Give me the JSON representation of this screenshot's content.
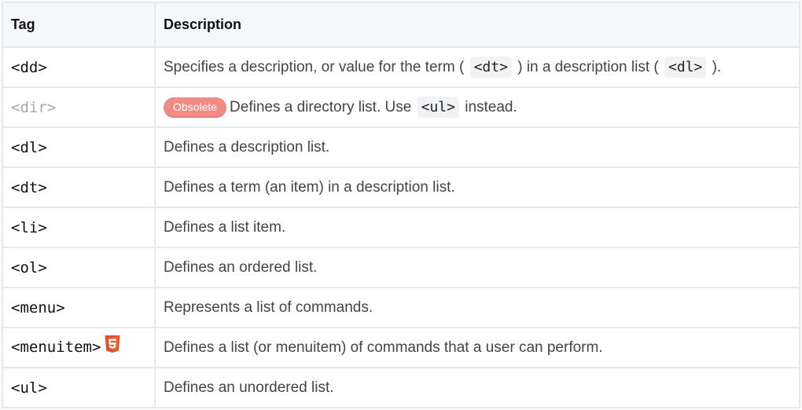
{
  "table": {
    "headers": {
      "tag": "Tag",
      "description": "Description"
    },
    "rows": [
      {
        "tag": "<dd>",
        "parts": [
          "Specifies a description, or value for the term (",
          "<dt>",
          ") in a description list (",
          "<dl>",
          ")."
        ]
      },
      {
        "tag": "<dir>",
        "badge": "Obsolete",
        "parts": [
          "Defines a directory list. Use",
          "<ul>",
          "instead."
        ]
      },
      {
        "tag": "<dl>",
        "description": "Defines a description list."
      },
      {
        "tag": "<dt>",
        "description": "Defines a term (an item) in a description list."
      },
      {
        "tag": "<li>",
        "description": "Defines a list item."
      },
      {
        "tag": "<ol>",
        "description": "Defines an ordered list."
      },
      {
        "tag": "<menu>",
        "description": "Represents a list of commands."
      },
      {
        "tag": "<menuitem>",
        "icon": "html5-icon",
        "description": "Defines a list (or menuitem) of commands that a user can perform."
      },
      {
        "tag": "<ul>",
        "description": "Defines an unordered list."
      }
    ]
  },
  "colors": {
    "badge": "#f28b85",
    "html5": "#e34f26",
    "border": "#e3e9f1",
    "header_bg": "#f5f7f9",
    "obsolete_text": "#a8a8a8"
  }
}
